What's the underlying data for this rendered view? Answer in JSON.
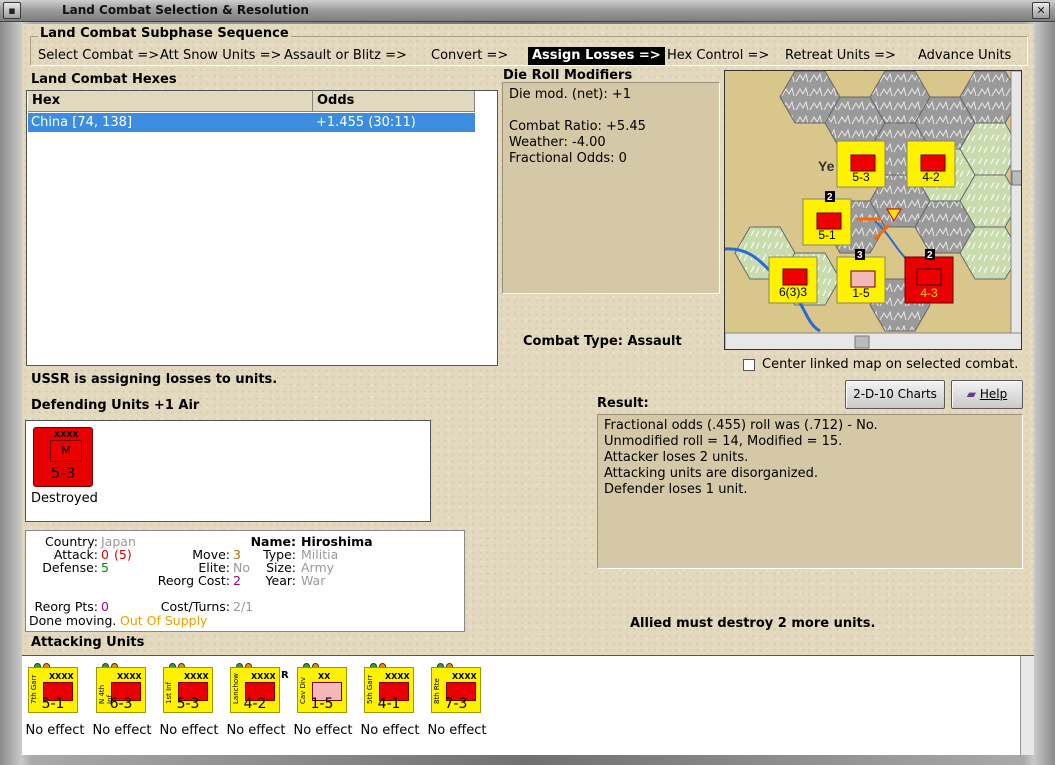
{
  "window": {
    "title": "Land Combat Selection & Resolution"
  },
  "phase": {
    "title": "Land Combat Subphase Sequence",
    "steps": [
      "Select Combat =>",
      "Att Snow Units =>",
      "Assault or Blitz =>",
      "Convert =>",
      "Assign Losses =>",
      "Hex Control =>",
      "Retreat Units =>",
      "Advance Units"
    ],
    "active_step": "Assign Losses =>"
  },
  "hexes": {
    "title": "Land Combat Hexes",
    "columns": [
      "Hex",
      "Odds"
    ],
    "rows": [
      {
        "hex": "China [74, 138]",
        "odds": "+1.455 (30:11)"
      }
    ]
  },
  "die_roll": {
    "title": "Die Roll Modifiers",
    "net": "Die mod. (net): +1",
    "combat_ratio": "Combat Ratio: +5.45",
    "weather": "Weather: -4.00",
    "fractional": "Fractional Odds: 0"
  },
  "combat_type": "Combat Type:  Assault",
  "center_checkbox": "Center linked map on selected combat.",
  "buttons": {
    "charts": "2-D-10 Charts",
    "help": "Help"
  },
  "status": "USSR is assigning losses to units.",
  "defending": {
    "title": "Defending Units +1 Air",
    "unit": {
      "name": "Hiroshima",
      "class": "XXXX",
      "symbol": "M",
      "strength": "5-3",
      "effect": "Destroyed"
    }
  },
  "info": {
    "country_k": "Country:",
    "country_v": "Japan",
    "attack_k": "Attack:",
    "attack_v": "0",
    "attack_v2": "(5)",
    "defense_k": "Defense:",
    "defense_v": "5",
    "move_k": "Move:",
    "move_v": "3",
    "elite_k": "Elite:",
    "elite_v": "No",
    "reorg_cost_k": "Reorg Cost:",
    "reorg_cost_v": "2",
    "name_k": "Name:",
    "name_v": "Hiroshima",
    "type_k": "Type:",
    "type_v": "Militia",
    "size_k": "Size:",
    "size_v": "Army",
    "year_k": "Year:",
    "year_v": "War",
    "reorg_pts_k": "Reorg Pts:",
    "reorg_pts_v": "0",
    "cost_turns_k": "Cost/Turns:",
    "cost_turns_v": "2/1",
    "done_k": "Done moving.",
    "done_v": "Out Of Supply"
  },
  "result": {
    "title": "Result:",
    "lines": [
      "Fractional odds (.455) roll was (.712)  - No.",
      "Unmodified roll = 14, Modified = 15.",
      "Attacker loses 2 units.",
      "Attacking units are disorganized.",
      "Defender loses 1 unit."
    ]
  },
  "allied_msg": "Allied must destroy 2 more units.",
  "attacking": {
    "title": "Attacking Units",
    "units": [
      {
        "name": "7th Garr",
        "class": "XXXX",
        "strength": "5-1",
        "effect": "No effect",
        "icon": "garrison"
      },
      {
        "name": "N 4th Inf",
        "class": "XXXX",
        "strength": "6-3",
        "effect": "No effect",
        "icon": "infantry"
      },
      {
        "name": "1st Inf",
        "class": "XXXX",
        "strength": "5-3",
        "effect": "No effect",
        "icon": "infantry"
      },
      {
        "name": "Lanchow",
        "class": "XXXX",
        "strength": "4-2",
        "effect": "No effect",
        "icon": "militia",
        "tag": "R"
      },
      {
        "name": "Cav Div",
        "class": "XX",
        "strength": "1-5",
        "effect": "No effect",
        "icon": "cavalry"
      },
      {
        "name": "5th Garr",
        "class": "XXXX",
        "strength": "4-1",
        "effect": "No effect",
        "icon": "garrison"
      },
      {
        "name": "8th Rte",
        "class": "XXXX",
        "strength": "7-3",
        "effect": "No effect",
        "icon": "infantry"
      }
    ]
  },
  "map": {
    "counters": [
      {
        "strength": "5-3",
        "class": "XXXX"
      },
      {
        "strength": "4-2",
        "class": "XXXX",
        "tag": "R"
      },
      {
        "strength": "5-1",
        "class": "XXXX"
      },
      {
        "strength": "6(3)3",
        "class": "XXXXX"
      },
      {
        "strength": "1-5",
        "class": "XX"
      },
      {
        "strength": "4-3",
        "class": ""
      }
    ],
    "stack_counts": [
      "2",
      "2",
      "3",
      "2",
      "3"
    ],
    "place_label": "Ye"
  }
}
